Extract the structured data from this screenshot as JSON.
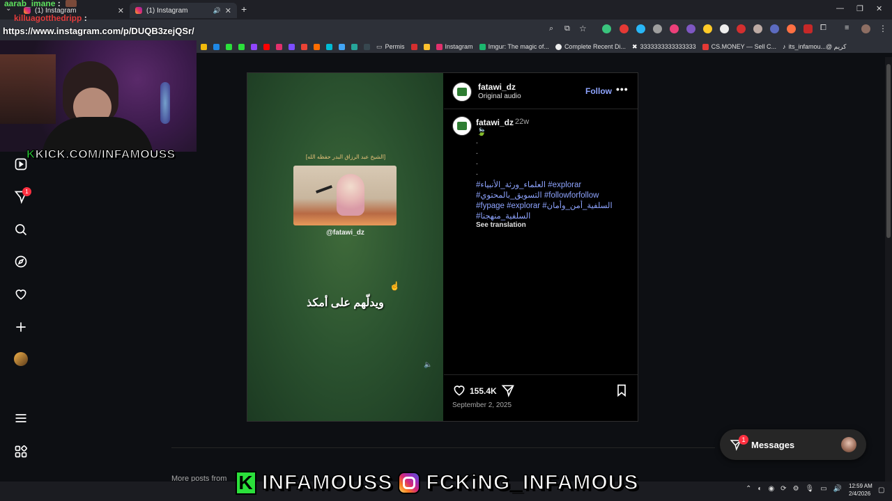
{
  "browser": {
    "tabs": [
      {
        "title": "(1) Instagram",
        "active": false
      },
      {
        "title": "(1) Instagram",
        "active": true
      }
    ],
    "url": "https://www.instagram.com/p/DUQB3zejQSr/",
    "bookmarks": [
      "Permis",
      "Instagram",
      "Imgur: The magic of...",
      "Complete Recent Di...",
      "3333333333333333",
      "CS.MONEY — Sell C...",
      "its_infamou...@ كريم"
    ]
  },
  "stream": {
    "chat": [
      {
        "user": "aarab_imane",
        "sep": ":"
      },
      {
        "user": "killuagotthedripp",
        "sep": ":"
      }
    ],
    "kick_tag_k": "K",
    "kick_tag": "KICK.COM/INFAMOUSS",
    "banner_k": "K",
    "banner_left": "INFAMOUSS",
    "banner_right": "FCKiNG_INFAMOUS"
  },
  "nav": {
    "notification_count": "1"
  },
  "post": {
    "video": {
      "heading": "[الشيخ عبد الرزاق البدر حفظه الله]",
      "handle": "@fatawi_dz",
      "subtitle": "ويدلّهم على أمكذ"
    },
    "author": "fatawi_dz",
    "audio": "Original audio",
    "follow_label": "Follow",
    "more_label": "•••",
    "caption": {
      "user": "fatawi_dz",
      "time": "22w",
      "emoji": "🍃",
      "dots": [
        ".",
        ".",
        ".",
        "."
      ],
      "tags": [
        "#العلماء_ورثة_الأنبياء #explorar",
        "#التسويق_بالمحتوي #followforfollow",
        "#fypage #explorar #السلفية_أمن_وأمان",
        "#السلفية_منهجنا"
      ],
      "see_translation": "See translation"
    },
    "likes": "155.4K",
    "date": "September 2, 2025"
  },
  "more_posts": "More posts from",
  "messages": {
    "label": "Messages",
    "badge": "1"
  },
  "taskbar": {
    "time": "12:59 AM",
    "date": "2/4/2026"
  },
  "colors": {
    "accent_link": "#8ea4ff",
    "badge": "#ff3040",
    "kick_green": "#2be03b"
  }
}
